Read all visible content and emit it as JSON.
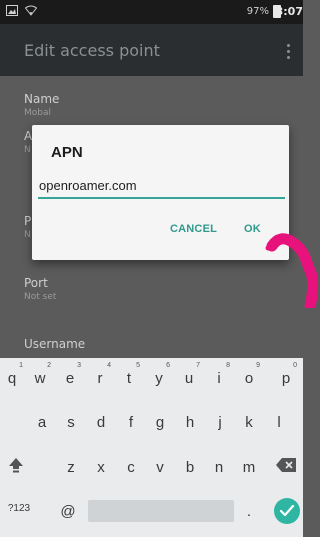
{
  "status_bar": {
    "battery": "97%",
    "time": "3:07"
  },
  "app_bar": {
    "title": "Edit access point"
  },
  "settings": [
    {
      "title": "Name",
      "subtitle": "Mobal"
    },
    {
      "title": "A",
      "subtitle": "N"
    },
    {
      "title": "P",
      "subtitle": "N"
    },
    {
      "title": "Port",
      "subtitle": "Not set"
    },
    {
      "title": "Username",
      "subtitle": ""
    }
  ],
  "dialog": {
    "title": "APN",
    "value": "openroamer.com",
    "cancel_label": "CANCEL",
    "ok_label": "OK"
  },
  "keyboard": {
    "row1": [
      {
        "key": "q",
        "hint": "1"
      },
      {
        "key": "w",
        "hint": "2"
      },
      {
        "key": "e",
        "hint": "3"
      },
      {
        "key": "r",
        "hint": "4"
      },
      {
        "key": "t",
        "hint": "5"
      },
      {
        "key": "y",
        "hint": "6"
      },
      {
        "key": "u",
        "hint": "7"
      },
      {
        "key": "i",
        "hint": "8"
      },
      {
        "key": "o",
        "hint": "9"
      },
      {
        "key": "p",
        "hint": "0"
      }
    ],
    "row2": [
      "a",
      "s",
      "d",
      "f",
      "g",
      "h",
      "j",
      "k",
      "l"
    ],
    "row3": [
      "z",
      "x",
      "c",
      "v",
      "b",
      "n",
      "m"
    ],
    "symbols_label": "?123",
    "at_label": "@",
    "period_label": "."
  },
  "colors": {
    "accent": "#2f9a8d",
    "enter_key": "#2fb6a3",
    "hand_mark": "#e8127c"
  },
  "icons": [
    "image-icon",
    "wifi-icon",
    "battery-icon",
    "more-vert-icon",
    "shift-icon",
    "backspace-icon",
    "check-icon"
  ]
}
